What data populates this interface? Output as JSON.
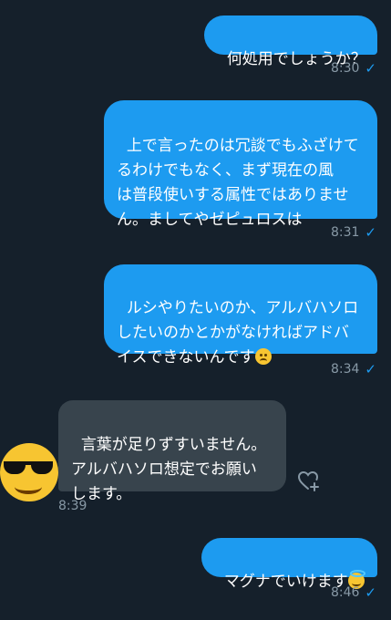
{
  "messages": [
    {
      "direction": "outgoing",
      "text": "何処用でしょうか？",
      "time": "8:30",
      "status": "✓"
    },
    {
      "direction": "outgoing",
      "text": "上で言ったのは冗談でもふざけて\nるわけでもなく、まず現在の風\nは普段使いする属性ではありませ\nん。ましてやゼピュロスは",
      "time": "8:31",
      "status": "✓"
    },
    {
      "direction": "outgoing",
      "text": "ルシやりたいのか、アルバハソロ\nしたいのかとかがなければアドバ\nイスできないんです",
      "emoji": "worried-face-icon",
      "time": "8:34",
      "status": "✓"
    },
    {
      "direction": "incoming",
      "text": "言葉が足りずすいません。\nアルバハソロ想定でお願い\nします。",
      "time": "8:39",
      "avatar": "sunglasses-face-icon"
    },
    {
      "direction": "outgoing",
      "text": "マグナでいけます",
      "emoji": "smiling-halo-face-icon",
      "time": "8:46",
      "status": "✓"
    }
  ],
  "colors": {
    "background": "#15202b",
    "outgoing_bubble": "#1d9bf0",
    "incoming_bubble": "#38444d",
    "timestamp": "#8899a6"
  }
}
